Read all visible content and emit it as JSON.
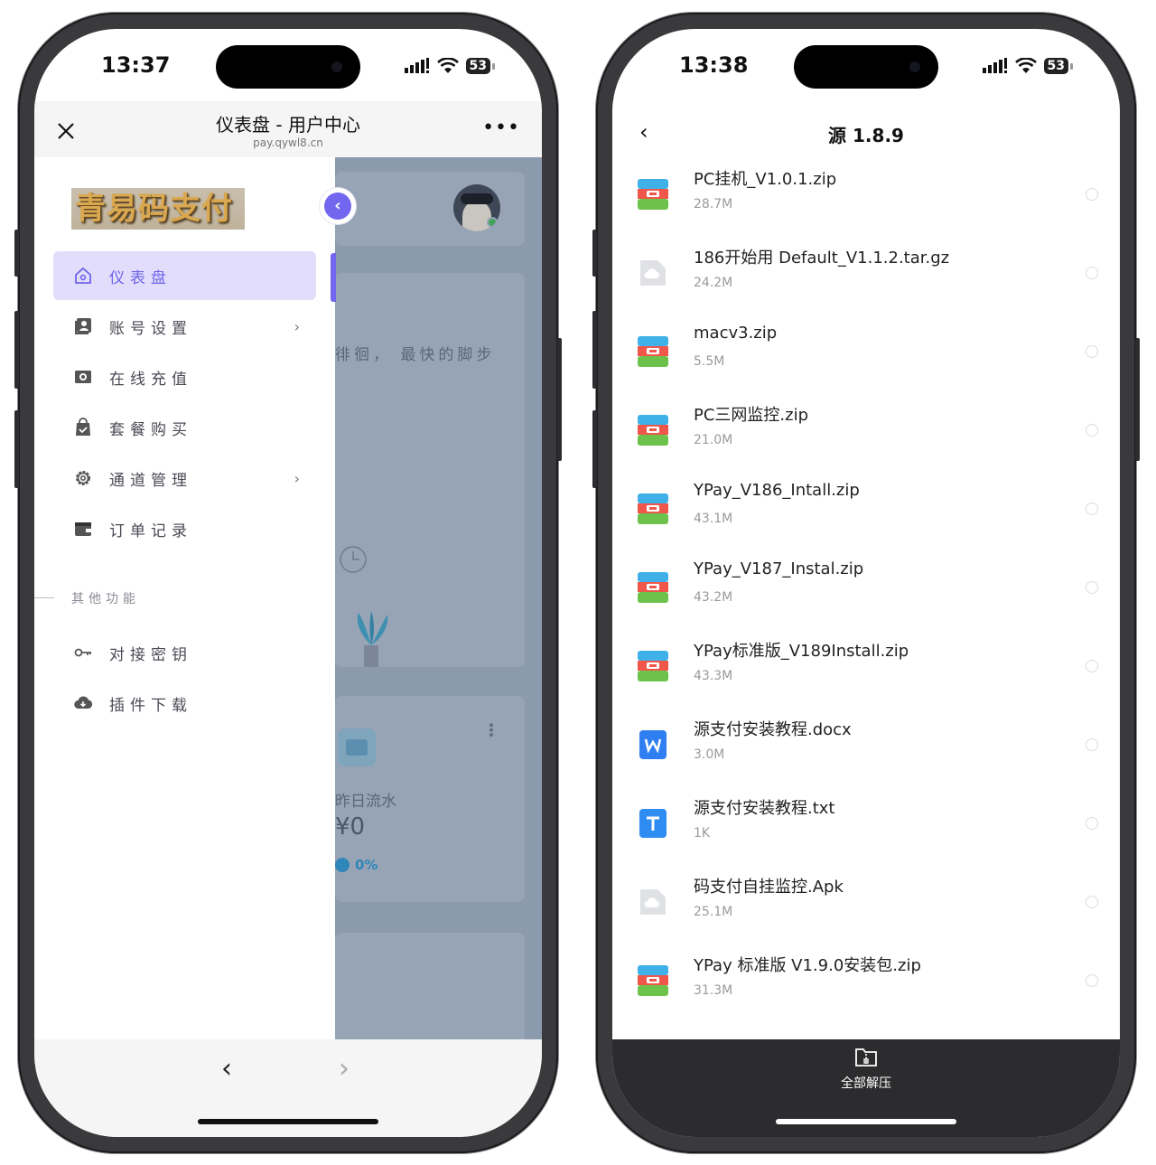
{
  "left_phone": {
    "status": {
      "time": "13:37",
      "battery": "53"
    },
    "header": {
      "title": "仪表盘 - 用户中心",
      "url": "pay.qywl8.cn",
      "more": "•••"
    },
    "logo_text": "青易码支付",
    "menu": [
      {
        "label": "仪表盘",
        "icon": "home-icon",
        "active": true,
        "has_chevron": false
      },
      {
        "label": "账号设置",
        "icon": "account-icon",
        "active": false,
        "has_chevron": true
      },
      {
        "label": "在线充值",
        "icon": "recharge-icon",
        "active": false,
        "has_chevron": false
      },
      {
        "label": "套餐购买",
        "icon": "shopping-bag-icon",
        "active": false,
        "has_chevron": false
      },
      {
        "label": "通道管理",
        "icon": "gear-icon",
        "active": false,
        "has_chevron": true
      },
      {
        "label": "订单记录",
        "icon": "wallet-icon",
        "active": false,
        "has_chevron": false
      }
    ],
    "section_label": "其他功能",
    "other_menu": [
      {
        "label": "对接密钥",
        "icon": "key-icon"
      },
      {
        "label": "插件下载",
        "icon": "cloud-download-icon"
      }
    ],
    "background": {
      "slogan": "徘徊， 最快的脚步",
      "card_label": "昨日流水",
      "card_value": "¥0",
      "card_percent": "0%"
    }
  },
  "right_phone": {
    "status": {
      "time": "13:38",
      "battery": "53"
    },
    "header": {
      "title": "源 1.8.9"
    },
    "files": [
      {
        "name": "PC挂机_V1.0.1.zip",
        "size": "28.7M",
        "type": "archive"
      },
      {
        "name": "186开始用 Default_V1.1.2.tar.gz",
        "size": "24.2M",
        "type": "cloud"
      },
      {
        "name": "macv3.zip",
        "size": "5.5M",
        "type": "archive"
      },
      {
        "name": "PC三网监控.zip",
        "size": "21.0M",
        "type": "archive"
      },
      {
        "name": "YPay_V186_Intall.zip",
        "size": "43.1M",
        "type": "archive"
      },
      {
        "name": "YPay_V187_Instal.zip",
        "size": "43.2M",
        "type": "archive"
      },
      {
        "name": "YPay标准版_V189Install.zip",
        "size": "43.3M",
        "type": "archive"
      },
      {
        "name": "源支付安装教程.docx",
        "size": "3.0M",
        "type": "word"
      },
      {
        "name": "源支付安装教程.txt",
        "size": "1K",
        "type": "text"
      },
      {
        "name": "码支付自挂监控.Apk",
        "size": "25.1M",
        "type": "cloud"
      },
      {
        "name": "YPay 标准版 V1.9.0安装包.zip",
        "size": "31.3M",
        "type": "archive"
      }
    ],
    "footer": {
      "extract_label": "全部解压"
    }
  },
  "colors": {
    "accent": "#7367f0",
    "active_bg": "#e1ddfb",
    "overlay": "#8c9aae",
    "footer_dark": "#2c2c2e"
  }
}
